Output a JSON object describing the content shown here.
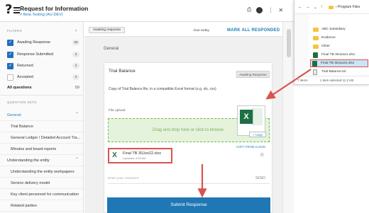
{
  "header": {
    "title": "Request for Information",
    "subtitle": "# Beta Testing (AU-DEV)"
  },
  "sidebar": {
    "filters_heading": "FILTERS",
    "filters": [
      {
        "label": "Awaiting Response",
        "count": "59",
        "checked": true
      },
      {
        "label": "Response Submitted",
        "count": "0",
        "checked": true
      },
      {
        "label": "Returned",
        "count": "0",
        "checked": true
      },
      {
        "label": "Accepted",
        "count": "0",
        "checked": false
      }
    ],
    "all_questions": {
      "label": "All questions",
      "count": "59"
    },
    "question_sets_heading": "QUESTION SETS",
    "items": [
      {
        "label": "General",
        "type": "section",
        "active": true
      },
      {
        "label": "Trial Balance",
        "type": "item"
      },
      {
        "label": "General Ledger / Detailed Account Tra...",
        "type": "item"
      },
      {
        "label": "Minutes and board reports",
        "type": "item"
      },
      {
        "label": "Understanding the entity",
        "type": "section",
        "active": false
      },
      {
        "label": "Understanding the entity workpapers",
        "type": "item"
      },
      {
        "label": "Service delivery model",
        "type": "item"
      },
      {
        "label": "Key client personnel for communication",
        "type": "item"
      },
      {
        "label": "Related parties",
        "type": "item"
      }
    ]
  },
  "main": {
    "status_pill": "Awaiting response",
    "due": "Due today",
    "mark_all": "MARK ALL RESPONDED",
    "section_title": "General",
    "card": {
      "title": "Trial Balance",
      "badge": "Awaiting Response",
      "description": "Copy of Trial Balance file, in a compatible Excel format (e.g. xls, csv)",
      "file_upload_label": "File upload",
      "drop_text": "Drag and drop here or click to browse",
      "copy_from_cloud": "COPY FROM CLOUD",
      "copy_badge": "+ Copy",
      "uploaded_file": {
        "name": "Final TB 30Jun22.xlsx",
        "meta": "Uploaded: 8:39 AM"
      },
      "comment_placeholder": "Enter your comment",
      "send": "SEND",
      "submit": "Submit Response"
    }
  },
  "explorer": {
    "path": "Program Files",
    "rows": [
      {
        "label": "ABC Subsidiary",
        "kind": "folder",
        "selected": false
      },
      {
        "label": "Evidence",
        "kind": "folder",
        "selected": false
      },
      {
        "label": "Other",
        "kind": "folder",
        "selected": false
      },
      {
        "label": "Final TB 30Jun21.xlsx",
        "kind": "excel",
        "selected": false
      },
      {
        "label": "Final TB 30Jun22.xlsx",
        "kind": "excel",
        "selected": true
      },
      {
        "label": "Trial Balance.txt",
        "kind": "text",
        "selected": false
      }
    ],
    "status_count": "7 items",
    "status_selected": "1 item selected 11.2 KB"
  },
  "colors": {
    "accent": "#1f77b4",
    "link": "#1a7fb5",
    "highlight": "#d9534f",
    "dropzone": "#e5f3dd",
    "excel": "#1d7044"
  }
}
